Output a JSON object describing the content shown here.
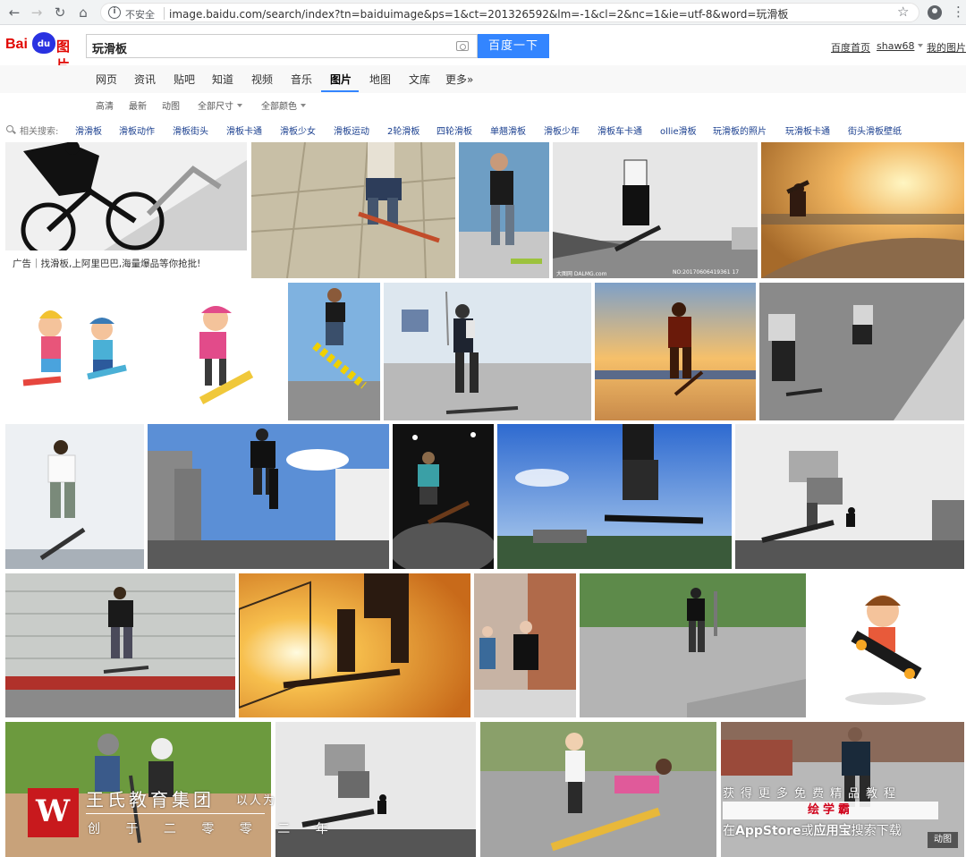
{
  "browser": {
    "insecure_label": "不安全",
    "url": "image.baidu.com/search/index?tn=baiduimage&ps=1&ct=201326592&lm=-1&cl=2&nc=1&ie=utf-8&word=玩滑板"
  },
  "header": {
    "logo_text": "Bai",
    "logo_paw": "du",
    "logo_images": "图片",
    "query": "玩滑板",
    "search_button": "百度一下",
    "links": {
      "home": "百度首页",
      "user": "shaw68",
      "my_images": "我的图片"
    }
  },
  "tabs": [
    "网页",
    "资讯",
    "贴吧",
    "知道",
    "视频",
    "音乐",
    "图片",
    "地图",
    "文库",
    "更多»"
  ],
  "active_tab": "图片",
  "filters": [
    "高清",
    "最新",
    "动图",
    "全部尺寸",
    "全部颜色"
  ],
  "related": {
    "label": "相关搜索:",
    "items": [
      "滑滑板",
      "滑板动作",
      "滑板街头",
      "滑板卡通",
      "滑板少女",
      "滑板运动",
      "2轮滑板",
      "四轮滑板",
      "单翘滑板",
      "滑板少年",
      "滑板车卡通",
      "ollie滑板",
      "玩滑板的照片",
      "玩滑板卡通",
      "街头滑板壁纸"
    ]
  },
  "ad_caption": "广告｜找滑板,上阿里巴巴,海量爆品等你抢批!",
  "image_watermark": "大图网 DALMG.com",
  "image_number": "NO:20170606419361 17",
  "watermark": {
    "logo_letter": "W",
    "company": "王氏教育集团",
    "slogan": "以人为",
    "sub": "创 于 二 零 零 二 年"
  },
  "promo": {
    "line1": "获得更多免费精品教程",
    "line2": "绘学霸",
    "line3_pre": "在",
    "line3_app": "AppStore",
    "line3_mid": "或",
    "line3_store": "应用宝",
    "line3_post": "搜索下载"
  },
  "gif_badge": "动图",
  "colors": {
    "accent": "#3385ff",
    "link": "#1a3f8f",
    "brand_red": "#e10601",
    "brand_blue": "#2932e1"
  }
}
